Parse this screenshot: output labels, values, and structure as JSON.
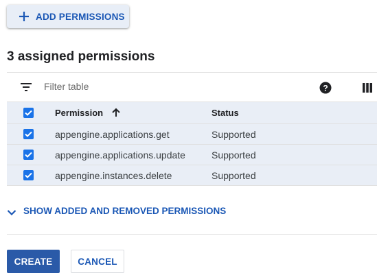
{
  "actions": {
    "add_permissions_label": "ADD PERMISSIONS",
    "add_icon": "plus-icon"
  },
  "section": {
    "heading": "3 assigned permissions"
  },
  "toolbar": {
    "filter_placeholder": "Filter table",
    "filter_value": "",
    "filter_icon": "filter-icon",
    "help_icon": "help-circle-icon",
    "columns_icon": "column-display-icon"
  },
  "table": {
    "columns": [
      {
        "label": "Permission",
        "sort": "ascending"
      },
      {
        "label": "Status"
      }
    ],
    "header_checked": true,
    "rows": [
      {
        "permission": "appengine.applications.get",
        "status": "Supported",
        "checked": true
      },
      {
        "permission": "appengine.applications.update",
        "status": "Supported",
        "checked": true
      },
      {
        "permission": "appengine.instances.delete",
        "status": "Supported",
        "checked": true
      }
    ]
  },
  "disclosure": {
    "label": "SHOW ADDED AND REMOVED PERMISSIONS",
    "icon": "chevron-down-icon"
  },
  "footer": {
    "create_label": "CREATE",
    "cancel_label": "CANCEL"
  },
  "colors": {
    "primary": "#1a73e8",
    "link": "#1a57b5",
    "create_button": "#2a5aa8",
    "selected_row": "#e9eef6"
  }
}
